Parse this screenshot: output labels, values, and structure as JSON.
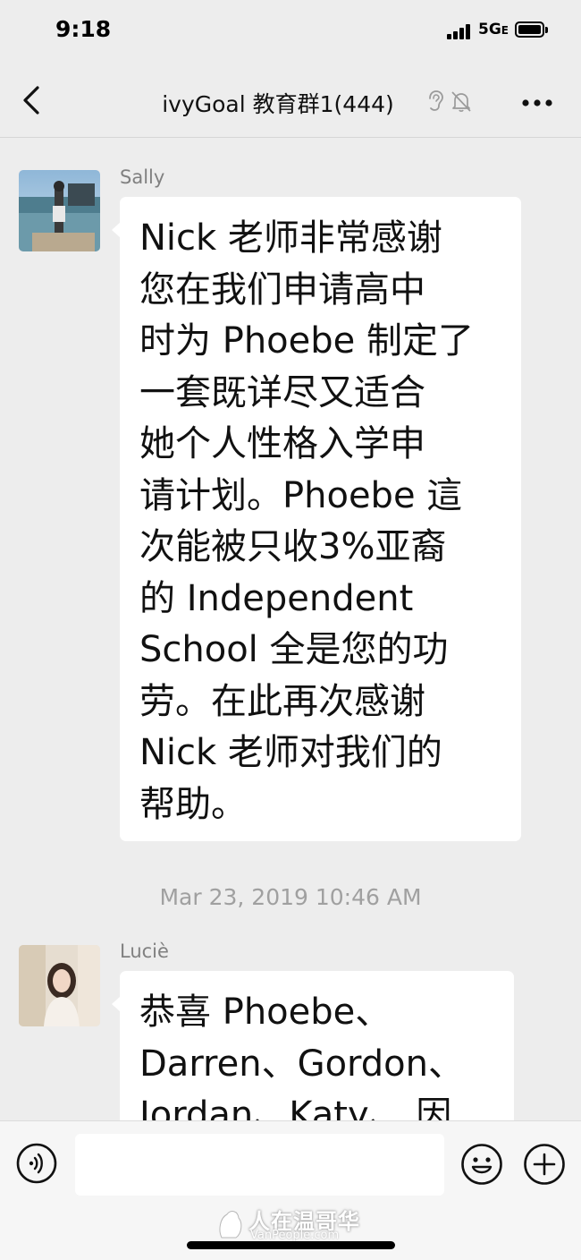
{
  "status_bar": {
    "time": "9:18",
    "network": "5G",
    "network_suffix": "E"
  },
  "header": {
    "title": "ivyGoal 教育群1(444)",
    "back_icon": "chevron-left-icon",
    "icons": [
      "ear-icon",
      "mute-bell-icon"
    ],
    "more_icon": "more-dots-icon"
  },
  "messages": [
    {
      "sender": "Sally",
      "text": "Nick 老师非常感谢\n您在我们申请高中\n时为 Phoebe 制定了\n一套既详尽又适合\n她个人性格入学申\n请计划。Phoebe 這\n次能被只收3%亚裔\n的 Independent\nSchool 全是您的功\n劳。在此再次感谢\nNick 老师对我们的\n帮助。"
    },
    {
      "timestamp": "Mar 23, 2019 10:46 AM"
    },
    {
      "sender": "Luciè",
      "text": "恭喜 Phoebe、\nDarren、Gordon、\nJordan、Katy、 因"
    }
  ],
  "input_bar": {
    "placeholder": "",
    "voice_icon": "voice-icon",
    "emoji_icon": "emoji-icon",
    "plus_icon": "plus-icon"
  },
  "watermark": {
    "main": "人在温哥华",
    "sub": "VanPeople.com"
  },
  "colors": {
    "background": "#ededed",
    "bubble": "#ffffff",
    "sender_name": "#808080",
    "timestamp": "#a0a0a0"
  }
}
